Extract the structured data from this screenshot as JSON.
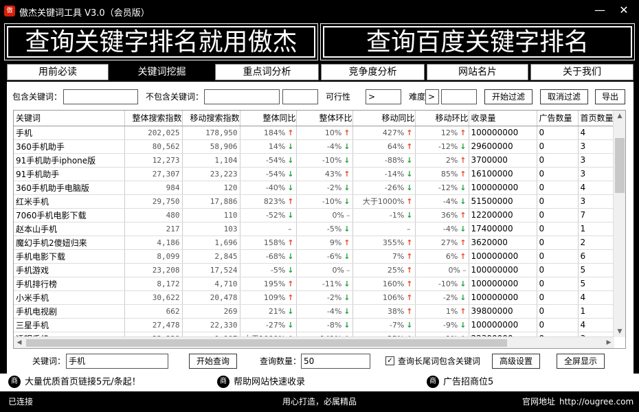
{
  "window": {
    "title": "傲杰关键词工具 V3.0（会员版）",
    "logo": "傲",
    "min": "—",
    "close": "✕"
  },
  "banners": {
    "left": "查询关键字排名就用傲杰",
    "right": "查询百度关键字排名"
  },
  "tabs": [
    "用前必读",
    "关键词挖掘",
    "重点词分析",
    "竞争度分析",
    "网站名片",
    "关于我们"
  ],
  "filters": {
    "include_label": "包含关键词：",
    "include_value": "",
    "exclude_label": "不包含关键词：",
    "exclude_value": "",
    "exclude_value2": "",
    "feasibility_label": "可行性",
    "feasibility_op": ">",
    "feasibility_value": "",
    "difficulty_label": "难度",
    "difficulty_op": ">",
    "difficulty_value": "",
    "start_filter": "开始过滤",
    "cancel_filter": "取消过滤",
    "export": "导出"
  },
  "table": {
    "headers": [
      "关键词",
      "整体搜索指数",
      "移动搜索指数",
      "整体同比",
      "整体环比",
      "移动同比",
      "移动环比",
      "收录量",
      "广告数量",
      "首页数量"
    ],
    "rows": [
      [
        "手机",
        "202,025",
        "178,950",
        "184%",
        "up",
        "10%",
        "up",
        "427%",
        "up",
        "12%",
        "up",
        "100000000",
        "0",
        "4"
      ],
      [
        "360手机助手",
        "80,562",
        "58,906",
        "14%",
        "down",
        "-4%",
        "down",
        "64%",
        "up",
        "-12%",
        "down",
        "29600000",
        "0",
        "3"
      ],
      [
        "91手机助手iphone版",
        "12,273",
        "1,104",
        "-54%",
        "down",
        "-10%",
        "down",
        "-88%",
        "down",
        "2%",
        "up",
        "3700000",
        "0",
        "3"
      ],
      [
        "91手机助手",
        "27,307",
        "23,223",
        "-54%",
        "down",
        "43%",
        "up",
        "-14%",
        "down",
        "85%",
        "up",
        "16100000",
        "0",
        "3"
      ],
      [
        "360手机助手电脑版",
        "984",
        "120",
        "-40%",
        "down",
        "-2%",
        "down",
        "-26%",
        "down",
        "-12%",
        "down",
        "100000000",
        "0",
        "4"
      ],
      [
        "红米手机",
        "29,750",
        "17,886",
        "823%",
        "up",
        "-10%",
        "down",
        "大于1000%",
        "up",
        "-4%",
        "down",
        "51500000",
        "0",
        "3"
      ],
      [
        "7060手机电影下载",
        "480",
        "110",
        "-52%",
        "down",
        "0%",
        "dash",
        "-1%",
        "down",
        "36%",
        "up",
        "12200000",
        "0",
        "7"
      ],
      [
        "赵本山手机",
        "217",
        "103",
        "–",
        "none",
        "-5%",
        "down",
        "–",
        "none",
        "-4%",
        "down",
        "17400000",
        "0",
        "1"
      ],
      [
        "魔幻手机2傻妞归来",
        "4,186",
        "1,696",
        "158%",
        "up",
        "9%",
        "up",
        "355%",
        "up",
        "27%",
        "up",
        "3620000",
        "0",
        "2"
      ],
      [
        "手机电影下载",
        "8,099",
        "2,845",
        "-68%",
        "down",
        "-6%",
        "down",
        "7%",
        "up",
        "6%",
        "up",
        "100000000",
        "0",
        "6"
      ],
      [
        "手机游戏",
        "23,208",
        "17,524",
        "-5%",
        "down",
        "0%",
        "dash",
        "25%",
        "up",
        "0%",
        "dash",
        "100000000",
        "0",
        "5"
      ],
      [
        "手机排行榜",
        "8,172",
        "4,710",
        "195%",
        "up",
        "-11%",
        "down",
        "160%",
        "up",
        "-10%",
        "down",
        "100000000",
        "0",
        "5"
      ],
      [
        "小米手机",
        "30,622",
        "20,478",
        "109%",
        "up",
        "-2%",
        "down",
        "106%",
        "up",
        "-2%",
        "down",
        "100000000",
        "0",
        "4"
      ],
      [
        "手机电视剧",
        "662",
        "269",
        "21%",
        "down",
        "-4%",
        "down",
        "38%",
        "up",
        "1%",
        "up",
        "39800000",
        "0",
        "1"
      ],
      [
        "三星手机",
        "27,478",
        "22,330",
        "-27%",
        "down",
        "-8%",
        "down",
        "-7%",
        "down",
        "-9%",
        "down",
        "100000000",
        "0",
        "4"
      ],
      [
        "透明手机",
        "22,229",
        "1,107",
        "大于1000%",
        "up",
        "141%",
        "up",
        "25%",
        "up",
        "1%",
        "up",
        "22300000",
        "0",
        "3"
      ]
    ]
  },
  "query": {
    "keyword_label": "关键词：",
    "keyword_value": "手机",
    "start_query": "开始查询",
    "count_label": "查询数量：",
    "count_value": "50",
    "longtail_label": "查询长尾词包含关键词",
    "longtail_checked": "✓",
    "advanced": "高级设置",
    "fullscreen": "全屏显示"
  },
  "ads": [
    {
      "icon": "商",
      "text": "大量优质首页链接5元/条起！"
    },
    {
      "icon": "商",
      "text": "帮助网站快速收录"
    },
    {
      "icon": "商",
      "text": "广告招商位5"
    }
  ],
  "status": {
    "left": "已连接",
    "center": "用心打造，必属精品",
    "site_label": "官网地址",
    "site_url": "http://ougree.com"
  },
  "colors": {
    "up": "#e84a2a",
    "down": "#1fa03a",
    "background": "#000000"
  },
  "icons": {
    "up": "arrow-up-icon",
    "down": "arrow-down-icon",
    "ad": "shop-icon"
  }
}
